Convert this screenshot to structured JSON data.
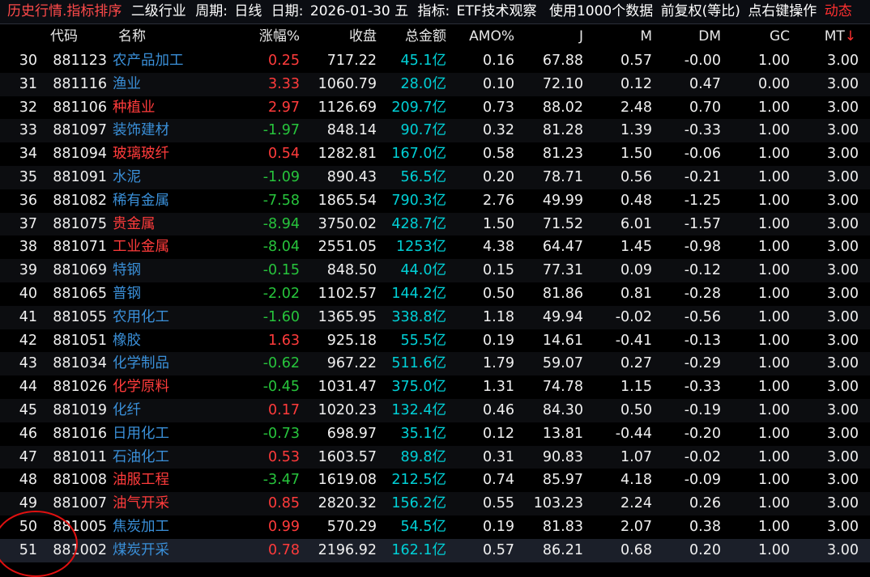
{
  "titlebar": {
    "module": "历史行情.指标排序",
    "industry": "二级行业",
    "period_label": "周期:",
    "period": "日线",
    "date_label": "日期:",
    "date": "2026-01-30 五",
    "indicator_label": "指标:",
    "indicator": "ETF技术观察",
    "data_info": "使用1000个数据",
    "adjust": "前复权(等比)",
    "hint": "点右键操作",
    "dynamic": "动态"
  },
  "columns": {
    "code": "代码",
    "name": "名称",
    "change_pct": "涨幅%",
    "close": "收盘",
    "total_amount": "总金额",
    "amo_pct": "AMO%",
    "j": "J",
    "m": "M",
    "dm": "DM",
    "gc": "GC",
    "mt": "MT",
    "mt_sort_icon": "↓"
  },
  "colors": {
    "up": "#ff3b3b",
    "down": "#27c43c",
    "name_default": "#3a8fd8",
    "amount": "#00d0d6",
    "annotation_circle": "#e01010"
  },
  "rows": [
    {
      "idx": "30",
      "code": "881123",
      "name": "农产品加工",
      "name_color": "blue",
      "change": "0.25",
      "dir": "up",
      "close": "717.22",
      "amount": "45.1亿",
      "amo": "0.16",
      "j": "67.88",
      "m": "0.57",
      "dm": "-0.00",
      "gc": "1.00",
      "mt": "3.00"
    },
    {
      "idx": "31",
      "code": "881116",
      "name": "渔业",
      "name_color": "blue",
      "change": "3.33",
      "dir": "up",
      "close": "1060.79",
      "amount": "28.0亿",
      "amo": "0.10",
      "j": "72.10",
      "m": "0.12",
      "dm": "0.47",
      "gc": "0.00",
      "mt": "3.00"
    },
    {
      "idx": "32",
      "code": "881106",
      "name": "种植业",
      "name_color": "red",
      "change": "2.97",
      "dir": "up",
      "close": "1126.69",
      "amount": "209.7亿",
      "amo": "0.73",
      "j": "88.02",
      "m": "2.48",
      "dm": "0.70",
      "gc": "1.00",
      "mt": "3.00"
    },
    {
      "idx": "33",
      "code": "881097",
      "name": "装饰建材",
      "name_color": "blue",
      "change": "-1.97",
      "dir": "down",
      "close": "848.14",
      "amount": "90.7亿",
      "amo": "0.32",
      "j": "81.28",
      "m": "1.39",
      "dm": "-0.33",
      "gc": "1.00",
      "mt": "3.00"
    },
    {
      "idx": "34",
      "code": "881094",
      "name": "玻璃玻纤",
      "name_color": "red",
      "change": "0.54",
      "dir": "up",
      "close": "1282.81",
      "amount": "167.0亿",
      "amo": "0.58",
      "j": "81.23",
      "m": "1.50",
      "dm": "-0.06",
      "gc": "1.00",
      "mt": "3.00"
    },
    {
      "idx": "35",
      "code": "881091",
      "name": "水泥",
      "name_color": "blue",
      "change": "-1.09",
      "dir": "down",
      "close": "890.43",
      "amount": "56.5亿",
      "amo": "0.20",
      "j": "78.71",
      "m": "0.56",
      "dm": "-0.21",
      "gc": "1.00",
      "mt": "3.00"
    },
    {
      "idx": "36",
      "code": "881082",
      "name": "稀有金属",
      "name_color": "blue",
      "change": "-7.58",
      "dir": "down",
      "close": "1865.54",
      "amount": "790.3亿",
      "amo": "2.76",
      "j": "49.99",
      "m": "0.48",
      "dm": "-1.25",
      "gc": "1.00",
      "mt": "3.00"
    },
    {
      "idx": "37",
      "code": "881075",
      "name": "贵金属",
      "name_color": "red",
      "change": "-8.94",
      "dir": "down",
      "close": "3750.02",
      "amount": "428.7亿",
      "amo": "1.50",
      "j": "71.52",
      "m": "6.01",
      "dm": "-1.57",
      "gc": "1.00",
      "mt": "3.00"
    },
    {
      "idx": "38",
      "code": "881071",
      "name": "工业金属",
      "name_color": "red",
      "change": "-8.04",
      "dir": "down",
      "close": "2551.05",
      "amount": "1253亿",
      "amo": "4.38",
      "j": "64.47",
      "m": "1.45",
      "dm": "-0.98",
      "gc": "1.00",
      "mt": "3.00"
    },
    {
      "idx": "39",
      "code": "881069",
      "name": "特钢",
      "name_color": "blue",
      "change": "-0.15",
      "dir": "down",
      "close": "848.50",
      "amount": "44.0亿",
      "amo": "0.15",
      "j": "77.31",
      "m": "0.09",
      "dm": "-0.12",
      "gc": "1.00",
      "mt": "3.00"
    },
    {
      "idx": "40",
      "code": "881065",
      "name": "普钢",
      "name_color": "blue",
      "change": "-2.02",
      "dir": "down",
      "close": "1102.57",
      "amount": "144.2亿",
      "amo": "0.50",
      "j": "81.86",
      "m": "0.81",
      "dm": "-0.28",
      "gc": "1.00",
      "mt": "3.00"
    },
    {
      "idx": "41",
      "code": "881055",
      "name": "农用化工",
      "name_color": "blue",
      "change": "-1.60",
      "dir": "down",
      "close": "1365.95",
      "amount": "338.8亿",
      "amo": "1.18",
      "j": "49.94",
      "m": "-0.02",
      "dm": "-0.56",
      "gc": "1.00",
      "mt": "3.00"
    },
    {
      "idx": "42",
      "code": "881051",
      "name": "橡胶",
      "name_color": "blue",
      "change": "1.63",
      "dir": "up",
      "close": "925.18",
      "amount": "55.5亿",
      "amo": "0.19",
      "j": "14.61",
      "m": "-0.41",
      "dm": "-0.13",
      "gc": "1.00",
      "mt": "3.00"
    },
    {
      "idx": "43",
      "code": "881034",
      "name": "化学制品",
      "name_color": "blue",
      "change": "-0.62",
      "dir": "down",
      "close": "967.22",
      "amount": "511.6亿",
      "amo": "1.79",
      "j": "59.07",
      "m": "0.27",
      "dm": "-0.29",
      "gc": "1.00",
      "mt": "3.00"
    },
    {
      "idx": "44",
      "code": "881026",
      "name": "化学原料",
      "name_color": "red",
      "change": "-0.45",
      "dir": "down",
      "close": "1031.47",
      "amount": "375.0亿",
      "amo": "1.31",
      "j": "74.78",
      "m": "1.15",
      "dm": "-0.33",
      "gc": "1.00",
      "mt": "3.00"
    },
    {
      "idx": "45",
      "code": "881019",
      "name": "化纤",
      "name_color": "blue",
      "change": "0.17",
      "dir": "up",
      "close": "1020.23",
      "amount": "132.4亿",
      "amo": "0.46",
      "j": "84.30",
      "m": "0.50",
      "dm": "-0.19",
      "gc": "1.00",
      "mt": "3.00"
    },
    {
      "idx": "46",
      "code": "881016",
      "name": "日用化工",
      "name_color": "blue",
      "change": "-0.73",
      "dir": "down",
      "close": "698.97",
      "amount": "35.1亿",
      "amo": "0.12",
      "j": "13.81",
      "m": "-0.44",
      "dm": "-0.20",
      "gc": "1.00",
      "mt": "3.00"
    },
    {
      "idx": "47",
      "code": "881011",
      "name": "石油化工",
      "name_color": "blue",
      "change": "0.53",
      "dir": "up",
      "close": "1603.57",
      "amount": "89.8亿",
      "amo": "0.31",
      "j": "90.83",
      "m": "1.07",
      "dm": "-0.02",
      "gc": "1.00",
      "mt": "3.00"
    },
    {
      "idx": "48",
      "code": "881008",
      "name": "油服工程",
      "name_color": "red",
      "change": "-3.47",
      "dir": "down",
      "close": "1619.08",
      "amount": "212.5亿",
      "amo": "0.74",
      "j": "85.97",
      "m": "4.18",
      "dm": "-0.09",
      "gc": "1.00",
      "mt": "3.00"
    },
    {
      "idx": "49",
      "code": "881007",
      "name": "油气开采",
      "name_color": "red",
      "change": "0.85",
      "dir": "up",
      "close": "2820.32",
      "amount": "156.2亿",
      "amo": "0.55",
      "j": "103.23",
      "m": "2.24",
      "dm": "0.26",
      "gc": "1.00",
      "mt": "3.00"
    },
    {
      "idx": "50",
      "code": "881005",
      "name": "焦炭加工",
      "name_color": "blue",
      "change": "0.99",
      "dir": "up",
      "close": "570.29",
      "amount": "54.5亿",
      "amo": "0.19",
      "j": "81.83",
      "m": "2.07",
      "dm": "0.38",
      "gc": "1.00",
      "mt": "3.00"
    },
    {
      "idx": "51",
      "code": "881002",
      "name": "煤炭开采",
      "name_color": "blue",
      "change": "0.78",
      "dir": "up",
      "close": "2196.92",
      "amount": "162.1亿",
      "amo": "0.57",
      "j": "86.21",
      "m": "0.68",
      "dm": "0.20",
      "gc": "1.00",
      "mt": "3.00",
      "selected": true
    }
  ]
}
